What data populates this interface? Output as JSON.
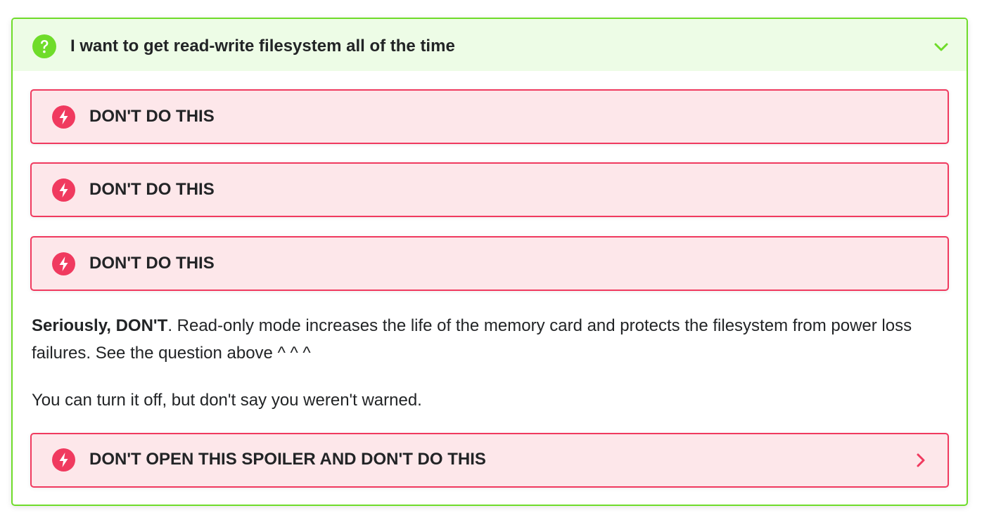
{
  "question": {
    "title": "I want to get read-write filesystem all of the time",
    "icon": "question-circle-icon",
    "expand_icon": "chevron-down-icon",
    "accent_color": "#6fdc2a",
    "header_bg": "#edfce6"
  },
  "warnings": [
    {
      "label": "DON'T DO THIS",
      "icon": "lightning-bolt-icon"
    },
    {
      "label": "DON'T DO THIS",
      "icon": "lightning-bolt-icon"
    },
    {
      "label": "DON'T DO THIS",
      "icon": "lightning-bolt-icon"
    }
  ],
  "body": {
    "para1_bold": "Seriously, DON'T",
    "para1_rest": ". Read-only mode increases the life of the memory card and protects the filesystem from power loss failures. See the question above ^ ^ ^",
    "para2": "You can turn it off, but don't say you weren't warned."
  },
  "spoiler": {
    "label": "DON'T OPEN THIS SPOILER AND DON'T DO THIS",
    "icon": "lightning-bolt-icon",
    "expand_icon": "chevron-right-icon"
  },
  "colors": {
    "danger_border": "#f03a5f",
    "danger_bg": "#fde7ea",
    "text": "#222426"
  }
}
